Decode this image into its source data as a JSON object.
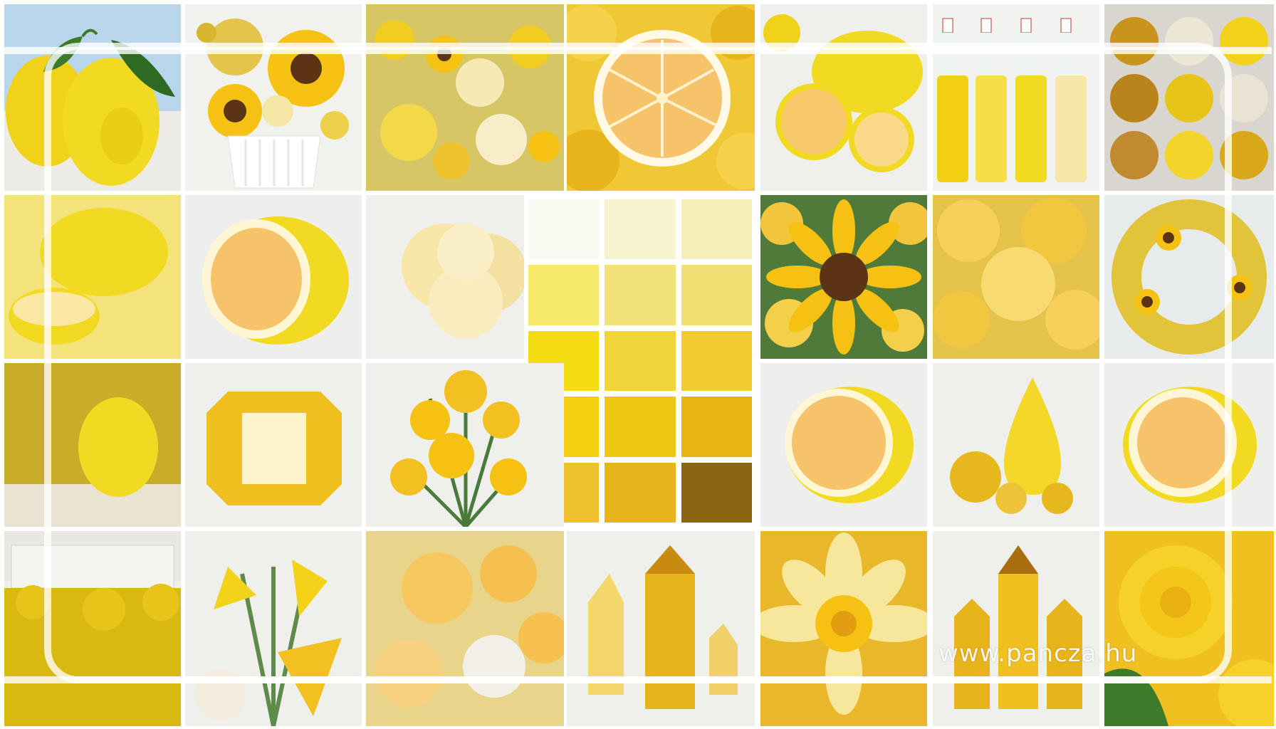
{
  "watermark": {
    "text": "www.pancza.hu"
  },
  "tiles": [
    {
      "name": "lemons-with-leaves",
      "kind": "lemon"
    },
    {
      "name": "sunflower-bouquet",
      "kind": "sunflower"
    },
    {
      "name": "yellow-flower-field",
      "kind": "flowers"
    },
    {
      "name": "grapefruit-half-on-roses",
      "kind": "citrus-half"
    },
    {
      "name": "lemon-and-slices",
      "kind": "lemon-slices"
    },
    {
      "name": "juice-bottles",
      "kind": "bottles"
    },
    {
      "name": "glitter-eggs",
      "kind": "eggs"
    },
    {
      "name": "lemon-with-slice-yellow-bg",
      "kind": "lemon"
    },
    {
      "name": "cut-lemon",
      "kind": "citrus-half"
    },
    {
      "name": "cream-carnation",
      "kind": "carnation"
    },
    {
      "name": "sunflower-with-roses",
      "kind": "sunflower"
    },
    {
      "name": "yellow-roses",
      "kind": "roses"
    },
    {
      "name": "sunflower-wreath",
      "kind": "wreath"
    },
    {
      "name": "lemon-in-garden",
      "kind": "lemon"
    },
    {
      "name": "yellow-gemstone",
      "kind": "gem"
    },
    {
      "name": "daffodil-bouquet",
      "kind": "daffodils"
    },
    {
      "name": "half-grapefruit",
      "kind": "citrus-half"
    },
    {
      "name": "yellow-drop-and-spheres",
      "kind": "drop"
    },
    {
      "name": "halved-lemon",
      "kind": "citrus-half"
    },
    {
      "name": "mansion-with-yellow-field",
      "kind": "field"
    },
    {
      "name": "yellow-lilies",
      "kind": "lilies"
    },
    {
      "name": "cream-rose-bouquet",
      "kind": "roses"
    },
    {
      "name": "citrine-crystals",
      "kind": "crystals"
    },
    {
      "name": "narcissus-flower",
      "kind": "narcissus"
    },
    {
      "name": "amber-crystal-prisms",
      "kind": "crystals"
    },
    {
      "name": "yellow-rose-closeup",
      "kind": "roses"
    }
  ],
  "palette": {
    "swatches": [
      "#fbfaf0",
      "#f8f3cf",
      "#f5eeb8",
      "#f6e86a",
      "#f3e27a",
      "#f1df73",
      "#f3dd12",
      "#f0d43a",
      "#f0cc30",
      "#f3cf10",
      "#eec810",
      "#e8b415",
      "#eec22d",
      "#e8b41c",
      "#8a6512"
    ]
  },
  "colors": {
    "lemon": "#f2d81c",
    "lemon-shadow": "#d9b400",
    "leaf": "#3d7a2a",
    "pulp": "#f7c36a",
    "rind": "#fff6d5",
    "sunflower": "#f5c213",
    "sunflower-center": "#5a3414",
    "bg-light": "#eeeeec",
    "bg-yellow": "#f4e27a"
  }
}
